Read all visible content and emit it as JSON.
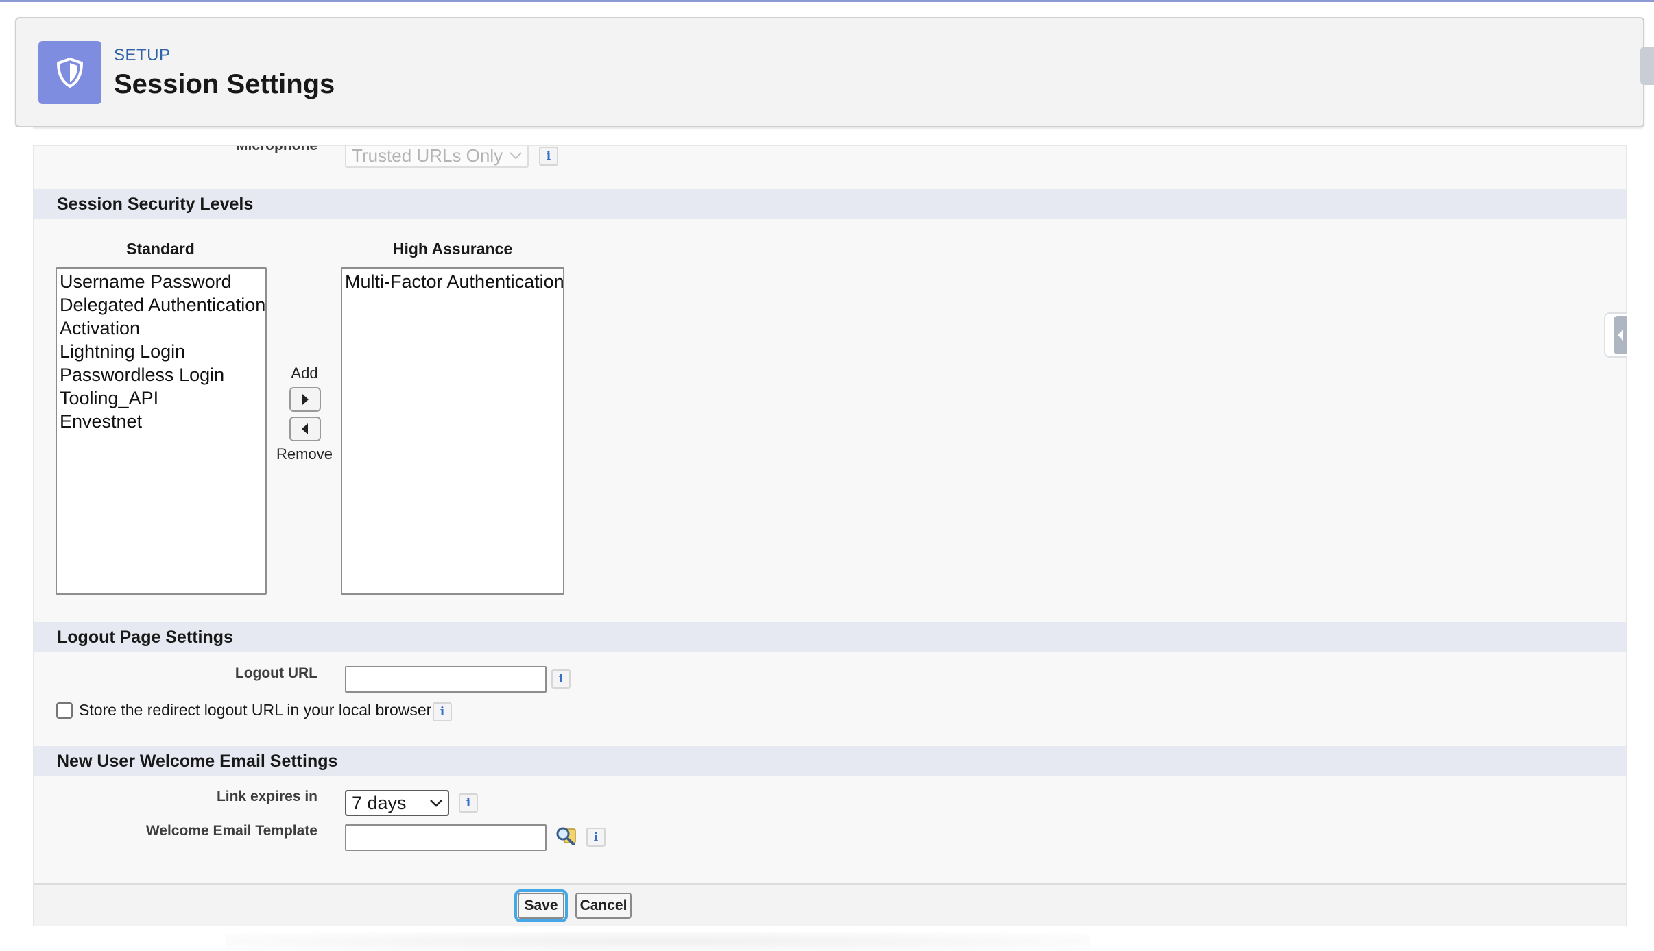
{
  "header": {
    "eyebrow": "SETUP",
    "title": "Session Settings",
    "icon": "shield-icon",
    "icon_bg": "#7f8de1"
  },
  "partial_row": {
    "label": "Microphone",
    "value": "Trusted URLs Only"
  },
  "session_security": {
    "heading": "Session Security Levels",
    "standard_label": "Standard",
    "high_label": "High Assurance",
    "standard_items": [
      "Username Password",
      "Delegated Authentication",
      "Activation",
      "Lightning Login",
      "Passwordless Login",
      "Tooling_API",
      "Envestnet"
    ],
    "high_items": [
      "Multi-Factor Authentication"
    ],
    "add_label": "Add",
    "remove_label": "Remove"
  },
  "logout": {
    "heading": "Logout Page Settings",
    "url_label": "Logout URL",
    "url_value": "",
    "store_label": "Store the redirect logout URL in your local browser"
  },
  "welcome_email": {
    "heading": "New User Welcome Email Settings",
    "expires_label": "Link expires in",
    "expires_value": "7 days",
    "template_label": "Welcome Email Template",
    "template_value": ""
  },
  "footer": {
    "save_label": "Save",
    "cancel_label": "Cancel"
  },
  "info_glyph": "i",
  "colors": {
    "accent_bar": "#8c9bd6",
    "section_bg": "#e6e9f1",
    "focus_ring": "#45a7e6"
  }
}
